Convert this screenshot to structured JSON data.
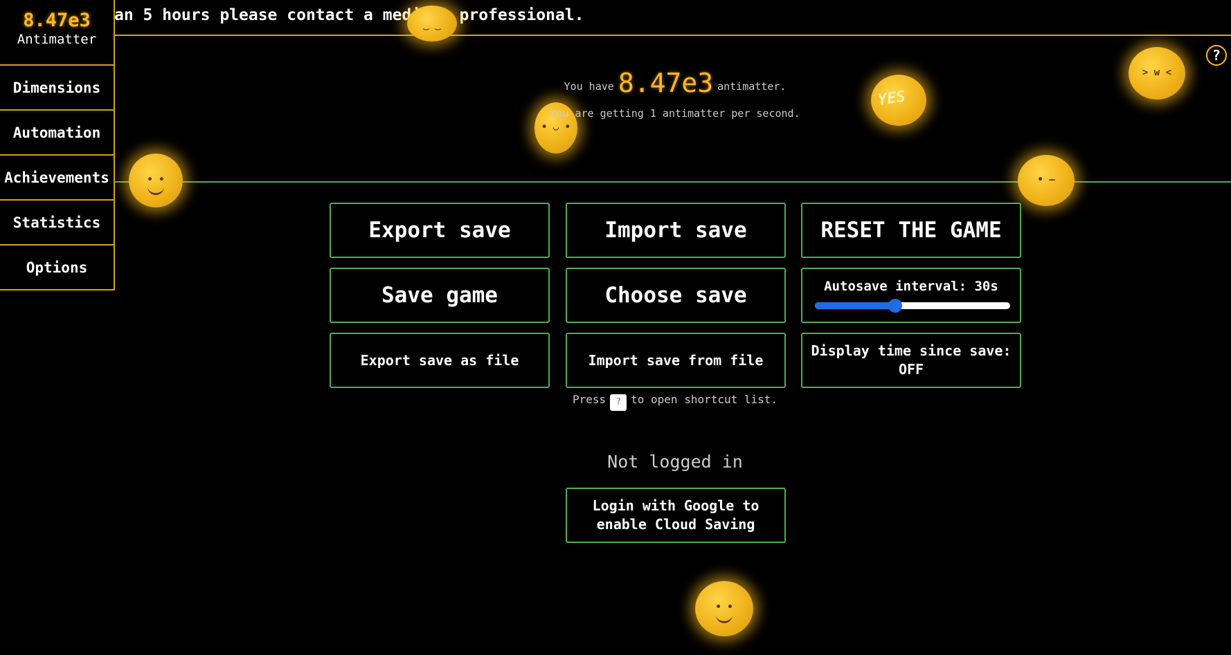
{
  "ticker": {
    "text": "an 5 hours please contact a medical professional."
  },
  "sidebar": {
    "resource_amount": "8.47e3",
    "resource_label": "Antimatter",
    "items": [
      {
        "label": "Dimensions"
      },
      {
        "label": "Automation"
      },
      {
        "label": "Achievements"
      },
      {
        "label": "Statistics"
      },
      {
        "label": "Options"
      }
    ]
  },
  "header": {
    "prefix": "You have",
    "amount": "8.47e3",
    "suffix": "antimatter.",
    "rate_text": "You are getting 1 antimatter per second."
  },
  "help": {
    "icon": "question-circle-icon",
    "glyph": "?"
  },
  "options": {
    "export_save": "Export save",
    "import_save": "Import save",
    "reset_game": "RESET THE GAME",
    "save_game": "Save game",
    "choose_save": "Choose save",
    "autosave_label": "Autosave interval: 30s",
    "autosave_seconds": 30,
    "autosave_fraction": 0.41,
    "export_file": "Export save as file",
    "import_file": "Import save from file",
    "display_time": "Display time since save:",
    "display_time_value": "OFF"
  },
  "shortcut": {
    "prefix": "Press",
    "key": "?",
    "suffix": "to open shortcut list."
  },
  "cloud": {
    "status": "Not logged in",
    "login_line1": "Login with Google to",
    "login_line2": "enable Cloud Saving"
  },
  "colors": {
    "accent": "#ffb81c",
    "border_gold": "#d6a21d",
    "border_green": "#4fae4f",
    "slider": "#1e6de6"
  }
}
